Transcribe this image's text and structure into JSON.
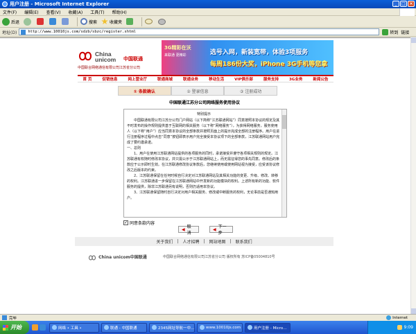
{
  "window": {
    "title": "用户注册 - Microsoft Internet Explorer",
    "min": "_",
    "max": "□",
    "close": "×"
  },
  "menu": [
    "文件(F)",
    "编辑(E)",
    "查看(V)",
    "收藏(A)",
    "工具(T)",
    "帮助(H)"
  ],
  "toolbar": {
    "back": "后退",
    "search": "搜索",
    "favorites": "收藏夹"
  },
  "address": {
    "label": "地址(D)",
    "url": "http://www.10010js.com/sdzb/sbzc/register.shtml",
    "go": "转到",
    "links": "链接"
  },
  "logo": {
    "en_line1": "China",
    "en_line2": "unicom",
    "cn": "中国联通",
    "sub": "中国联合网络通信有限公司江苏省分公司"
  },
  "banner": {
    "line1": "3G精彩在沃",
    "line2": "来联通 更精彩",
    "line3": "选号入网，新装宽带，体验3项服务",
    "line4": "每周186份大奖，iPhone 3G手机等您拿"
  },
  "nav": [
    "首 页",
    "促销信息",
    "网上营业厅",
    "联通商城",
    "联通业务",
    "移动生活",
    "VIP俱乐部",
    "服务支持",
    "3G业务",
    "新闻公告"
  ],
  "steps": [
    "① 条款确认",
    "② 登录信息",
    "③ 注册成功"
  ],
  "agreement": {
    "title": "中国联通江苏分公司网络服务使用协议",
    "header": "特别提示",
    "p1": "中国联通有限公司江苏分公司门户网站（以下简称“江苏联通网站”）同意按照本协议的规定及其不时发布的操作规则提供基于互联网的相关服务（以下称“网络服务”），为获得网络服务，服务使用人（以下称“用户”）应当同意本协议的全部条款并按照页面上的提示完成全部的注册程序。用户在进行注册程序过程中点击“同意”按钮即表示用户完全接受本协议项下的全部条款，江苏联通网站用户完成了要约邀承诺。",
    "s1": "一、总则",
    "p2": "1、用户在使用江苏联通网站提供的各项服务的同时，承诺接受并遵守各项相关规则的规定。江苏联通有权随时修改本协议，并只需公示于江苏联通网站上，而无需征得您的事先同意。修改后的条款应于公示即时生效。在江苏联通修改协议条款后，您继续使用或使用网站视为接受，应受该协议修改之后版本的约束。",
    "p3": "2、江苏联通保留在任何时候自行决定对江苏联通网站及其相关功能的变更、升级、修改、转移的权利。江苏联通进一步保留在江苏联通网站中开发新的功能模块的权利。上述所有新的功能、软件服务的提供，除非江苏联通另有说明，否则仍适用本协议。",
    "p4": "3、江苏联通保留随时自行决定对用户相关服务、修改或中断服务的权利，无论事前是否通知用户。"
  },
  "checkbox": {
    "label": "同意条款内容",
    "mark": "✓"
  },
  "buttons": {
    "prev": "取 消",
    "next": "下一步",
    "arrow": "◀"
  },
  "footer": {
    "links": [
      "关于我们",
      "人才招聘",
      "网站地图",
      "联系我们"
    ],
    "sep": "|",
    "logo_text": "China unicom中国联通",
    "copyright": "中国联合网络通信有限公司江苏省分公司  版权所有  苏ICP备05004810号"
  },
  "status": {
    "text": "完毕",
    "zone": "Internet"
  },
  "taskbar": {
    "start": "开始",
    "tasks": [
      "网络 • 工具 •",
      "联通 - 中国联通",
      "2345网址导航一中…",
      "www.10010js.com",
      "用户注册 - Micro…"
    ],
    "clock": "9:09"
  },
  "colors": {
    "brand_red": "#cc0000",
    "xp_blue": "#0a5fd8"
  }
}
